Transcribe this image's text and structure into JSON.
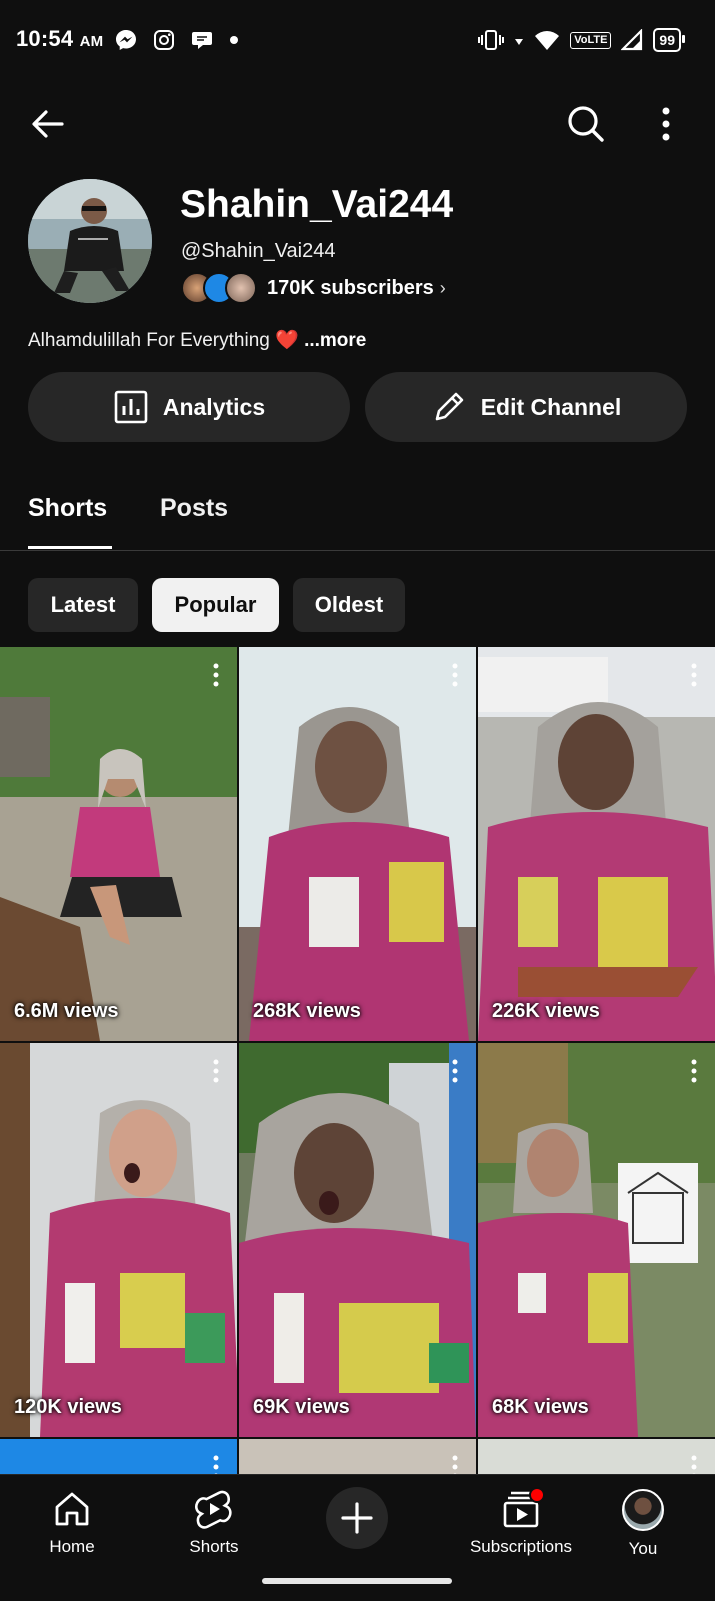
{
  "status_bar": {
    "time": "10:54",
    "ampm": "AM",
    "volte": "VoLTE",
    "battery": "99"
  },
  "channel": {
    "name": "Shahin_Vai244",
    "handle": "@Shahin_Vai244",
    "subscribers": "170K subscribers",
    "description": "Alhamdulillah For Everything",
    "heart": "❤️",
    "more_label": "...more"
  },
  "actions": {
    "analytics": "Analytics",
    "edit_channel": "Edit Channel"
  },
  "tabs": [
    {
      "label": "Shorts",
      "active": true
    },
    {
      "label": "Posts",
      "active": false
    }
  ],
  "chips": [
    {
      "label": "Latest",
      "selected": false
    },
    {
      "label": "Popular",
      "selected": true
    },
    {
      "label": "Oldest",
      "selected": false
    }
  ],
  "shorts": [
    {
      "views": "6.6M views"
    },
    {
      "views": "268K views"
    },
    {
      "views": "226K views"
    },
    {
      "views": "120K views"
    },
    {
      "views": "69K views"
    },
    {
      "views": "68K views"
    }
  ],
  "nav": [
    {
      "label": "Home",
      "icon": "home-icon"
    },
    {
      "label": "Shorts",
      "icon": "shorts-icon"
    },
    {
      "label": "",
      "icon": "create-icon"
    },
    {
      "label": "Subscriptions",
      "icon": "subscriptions-icon"
    },
    {
      "label": "You",
      "icon": "you-avatar"
    }
  ],
  "colors": {
    "background": "#0f0f0f",
    "button": "#272727",
    "chip_selected": "#f1f1f1",
    "notification_dot": "#ff0000"
  }
}
